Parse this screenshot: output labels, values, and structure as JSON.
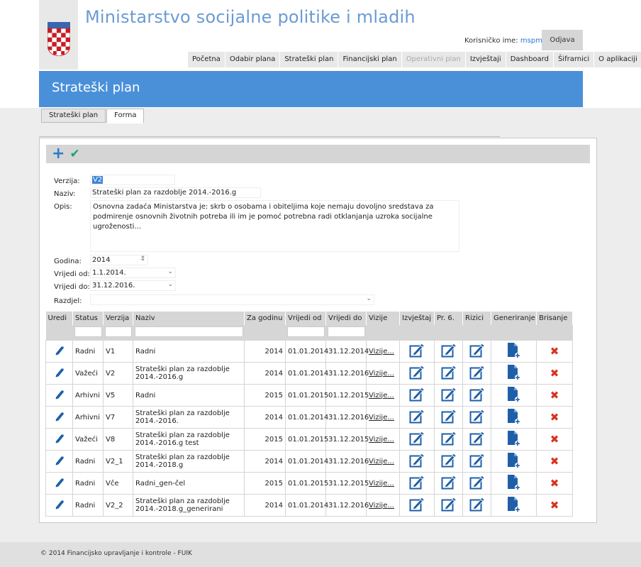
{
  "app": {
    "title": "Ministarstvo socijalne politike i mladih",
    "user_label": "Korisničko ime:",
    "username": "mspm",
    "logout": "Odjava"
  },
  "nav": [
    {
      "label": "Početna",
      "disabled": false
    },
    {
      "label": "Odabir plana",
      "disabled": false
    },
    {
      "label": "Strateški plan",
      "disabled": false
    },
    {
      "label": "Financijski plan",
      "disabled": false
    },
    {
      "label": "Operativni plan",
      "disabled": true
    },
    {
      "label": "Izvještaji",
      "disabled": false
    },
    {
      "label": "Dashboard",
      "disabled": false
    },
    {
      "label": "Šifrarnici",
      "disabled": false
    },
    {
      "label": "O aplikaciji",
      "disabled": false
    }
  ],
  "banner": {
    "title": "Strateški plan"
  },
  "tabs": [
    {
      "label": "Strateški plan",
      "active": false
    },
    {
      "label": "Forma",
      "active": true
    }
  ],
  "form": {
    "verzija_label": "Verzija:",
    "verzija": "V2",
    "naziv_label": "Naziv:",
    "naziv": "Strateški plan za razdoblje 2014.-2016.g",
    "opis_label": "Opis:",
    "opis": "Osnovna zadaća Ministarstva je: skrb o osobama i obiteljima koje nemaju dovoljno sredstava za podmirenje osnovnih životnih potreba ili im je pomoć potrebna radi otklanjanja uzroka socijalne ugroženosti...",
    "godina_label": "Godina:",
    "godina": "2014",
    "vrijedi_od_label": "Vrijedi od:",
    "vrijedi_od": "1.1.2014.",
    "vrijedi_do_label": "Vrijedi do:",
    "vrijedi_do": "31.12.2016.",
    "razdjel_label": "Razdjel:",
    "razdjel": ""
  },
  "table": {
    "headers": [
      "Uredi",
      "Status",
      "Verzija",
      "Naziv",
      "Za godinu",
      "Vrijedi od",
      "Vrijedi do",
      "Vizije",
      "Izvještaj",
      "Pr. 6.",
      "Rizici",
      "Generiranje",
      "Brisanje"
    ],
    "vizije_link": "Vizije...",
    "rows": [
      {
        "status": "Radni",
        "verzija": "V1",
        "naziv": "Radni",
        "godina": "2014",
        "od": "01.01.2014",
        "do": "31.12.2014"
      },
      {
        "status": "Važeći",
        "verzija": "V2",
        "naziv": "Strateški plan za razdoblje 2014.-2016.g",
        "godina": "2014",
        "od": "01.01.2014",
        "do": "31.12.2016"
      },
      {
        "status": "Arhivni",
        "verzija": "V5",
        "naziv": "Radni",
        "godina": "2015",
        "od": "01.01.2015",
        "do": "01.12.2015"
      },
      {
        "status": "Arhivni",
        "verzija": "V7",
        "naziv": "Strateški plan za razdoblje 2014.-2016.",
        "godina": "2014",
        "od": "01.01.2014",
        "do": "31.12.2016"
      },
      {
        "status": "Važeći",
        "verzija": "V8",
        "naziv": "Strateški plan za razdoblje 2014.-2016.g test",
        "godina": "2015",
        "od": "01.01.2015",
        "do": "31.12.2015"
      },
      {
        "status": "Radni",
        "verzija": "V2_1",
        "naziv": "Strateški plan za razdoblje 2014.-2018.g",
        "godina": "2014",
        "od": "01.01.2014",
        "do": "31.12.2016"
      },
      {
        "status": "Radni",
        "verzija": "Vče",
        "naziv": "Radni_gen-čel",
        "godina": "2015",
        "od": "01.01.2015",
        "do": "31.12.2015"
      },
      {
        "status": "Radni",
        "verzija": "V2_2",
        "naziv": "Strateški plan za razdoblje 2014.-2018.g_generirani",
        "godina": "2014",
        "od": "01.01.2014",
        "do": "31.12.2016"
      }
    ]
  },
  "footer": {
    "text": "© 2014 Financijsko upravljanje i kontrole - FUIK"
  },
  "colors": {
    "accent": "#4a90d9",
    "title": "#6b9bd2",
    "delete": "#d9321f",
    "confirm": "#1aa36a",
    "icon": "#1f5fa8"
  }
}
